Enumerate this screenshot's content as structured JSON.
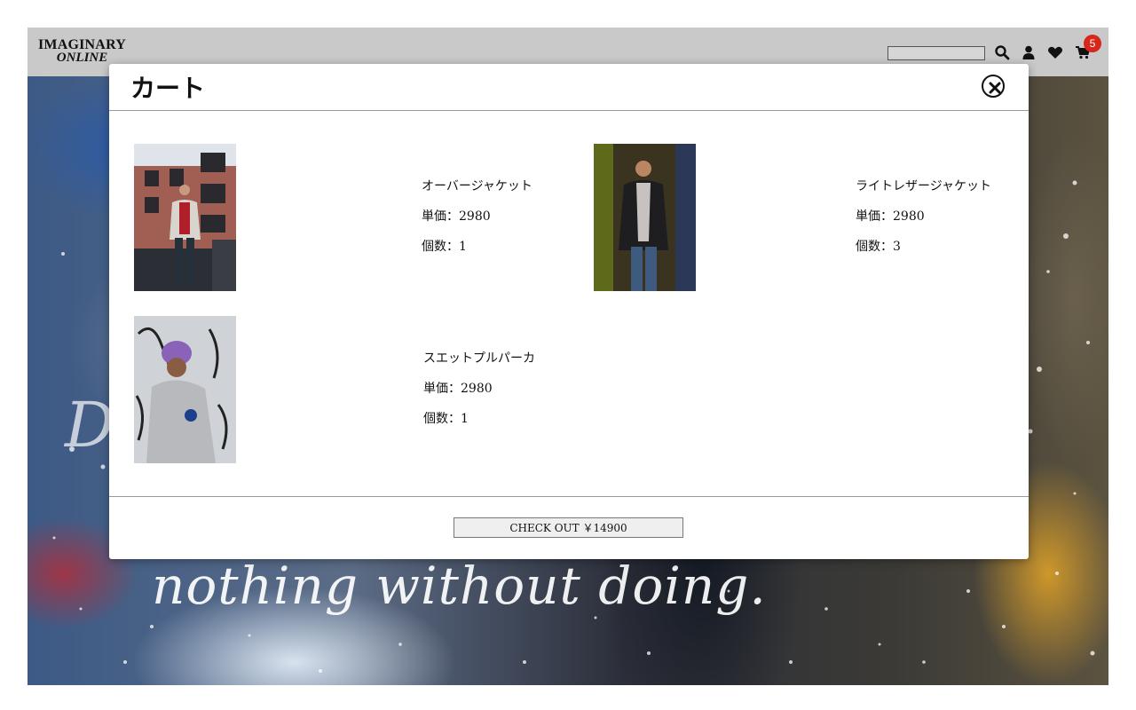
{
  "header": {
    "logo_line1": "IMAGINARY",
    "logo_line2": "ONLINE",
    "search_placeholder": "",
    "cart_count": "5",
    "icons": [
      "search-icon",
      "user-icon",
      "heart-icon",
      "cart-icon"
    ]
  },
  "hero": {
    "tagline": "nothing without doing.",
    "partial_letter": "D"
  },
  "modal": {
    "title": "カート",
    "items": [
      {
        "name": "オーバージャケット",
        "price": "単価：2980",
        "qty": "個数：1"
      },
      {
        "name": "ライトレザージャケット",
        "price": "単価：2980",
        "qty": "個数：3"
      },
      {
        "name": "スエットプルパーカ",
        "price": "単価：2980",
        "qty": "個数：1"
      }
    ],
    "checkout_label": "CHECK OUT ￥14900"
  },
  "colors": {
    "header_bg": "#c9c9c9",
    "badge": "#d7261b",
    "modal_bg": "#ffffff"
  }
}
